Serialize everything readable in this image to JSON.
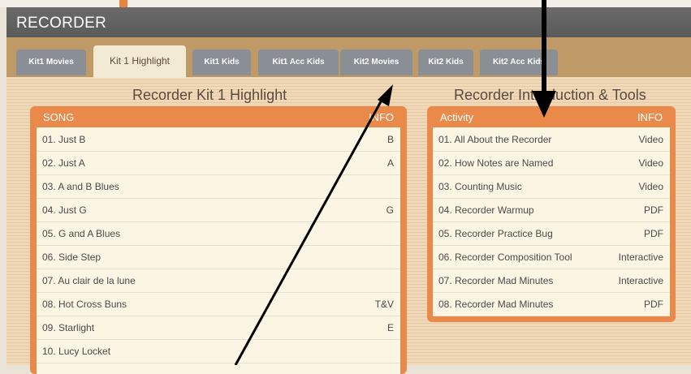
{
  "window": {
    "title": "RECORDER"
  },
  "tabs": [
    {
      "label": "Kit1 Movies"
    },
    {
      "label": "Kit 1 Highlight"
    },
    {
      "label": "Kit1 Kids"
    },
    {
      "label": "Kit1 Acc Kids"
    },
    {
      "label": "Kit2 Movies"
    },
    {
      "label": "Kit2 Kids"
    },
    {
      "label": "Kit2 Acc Kids"
    }
  ],
  "left_section": {
    "title": "Recorder Kit 1 Highlight",
    "col_song": "SONG",
    "col_info": "INFO",
    "rows": [
      {
        "song": "01. Just B",
        "info": "B"
      },
      {
        "song": "02. Just A",
        "info": "A"
      },
      {
        "song": "03. A and B Blues",
        "info": ""
      },
      {
        "song": "04. Just G",
        "info": "G"
      },
      {
        "song": "05. G and A Blues",
        "info": ""
      },
      {
        "song": "06. Side Step",
        "info": ""
      },
      {
        "song": "07. Au clair de la lune",
        "info": ""
      },
      {
        "song": "08. Hot Cross Buns",
        "info": "T&V"
      },
      {
        "song": "09. Starlight",
        "info": "E"
      },
      {
        "song": "10. Lucy Locket",
        "info": ""
      }
    ]
  },
  "right_section": {
    "title": "Recorder Introduction & Tools",
    "col_activity": "Activity",
    "col_info": "INFO",
    "rows": [
      {
        "activity": "01. All About the Recorder",
        "info": "Video"
      },
      {
        "activity": "02. How Notes are Named",
        "info": "Video"
      },
      {
        "activity": "03. Counting Music",
        "info": "Video"
      },
      {
        "activity": "04. Recorder Warmup",
        "info": "PDF"
      },
      {
        "activity": "05. Recorder Practice Bug",
        "info": "PDF"
      },
      {
        "activity": "06. Recorder Composition Tool",
        "info": "Interactive"
      },
      {
        "activity": "07. Recorder Mad Minutes",
        "info": "Interactive"
      },
      {
        "activity": "08. Recorder Mad Minutes",
        "info": "PDF"
      }
    ]
  },
  "colors": {
    "accent": "#ea8a4a",
    "tab_bar": "#bf9a66",
    "tab": "#8a8f96",
    "title_bar": "#5a5a5a"
  }
}
